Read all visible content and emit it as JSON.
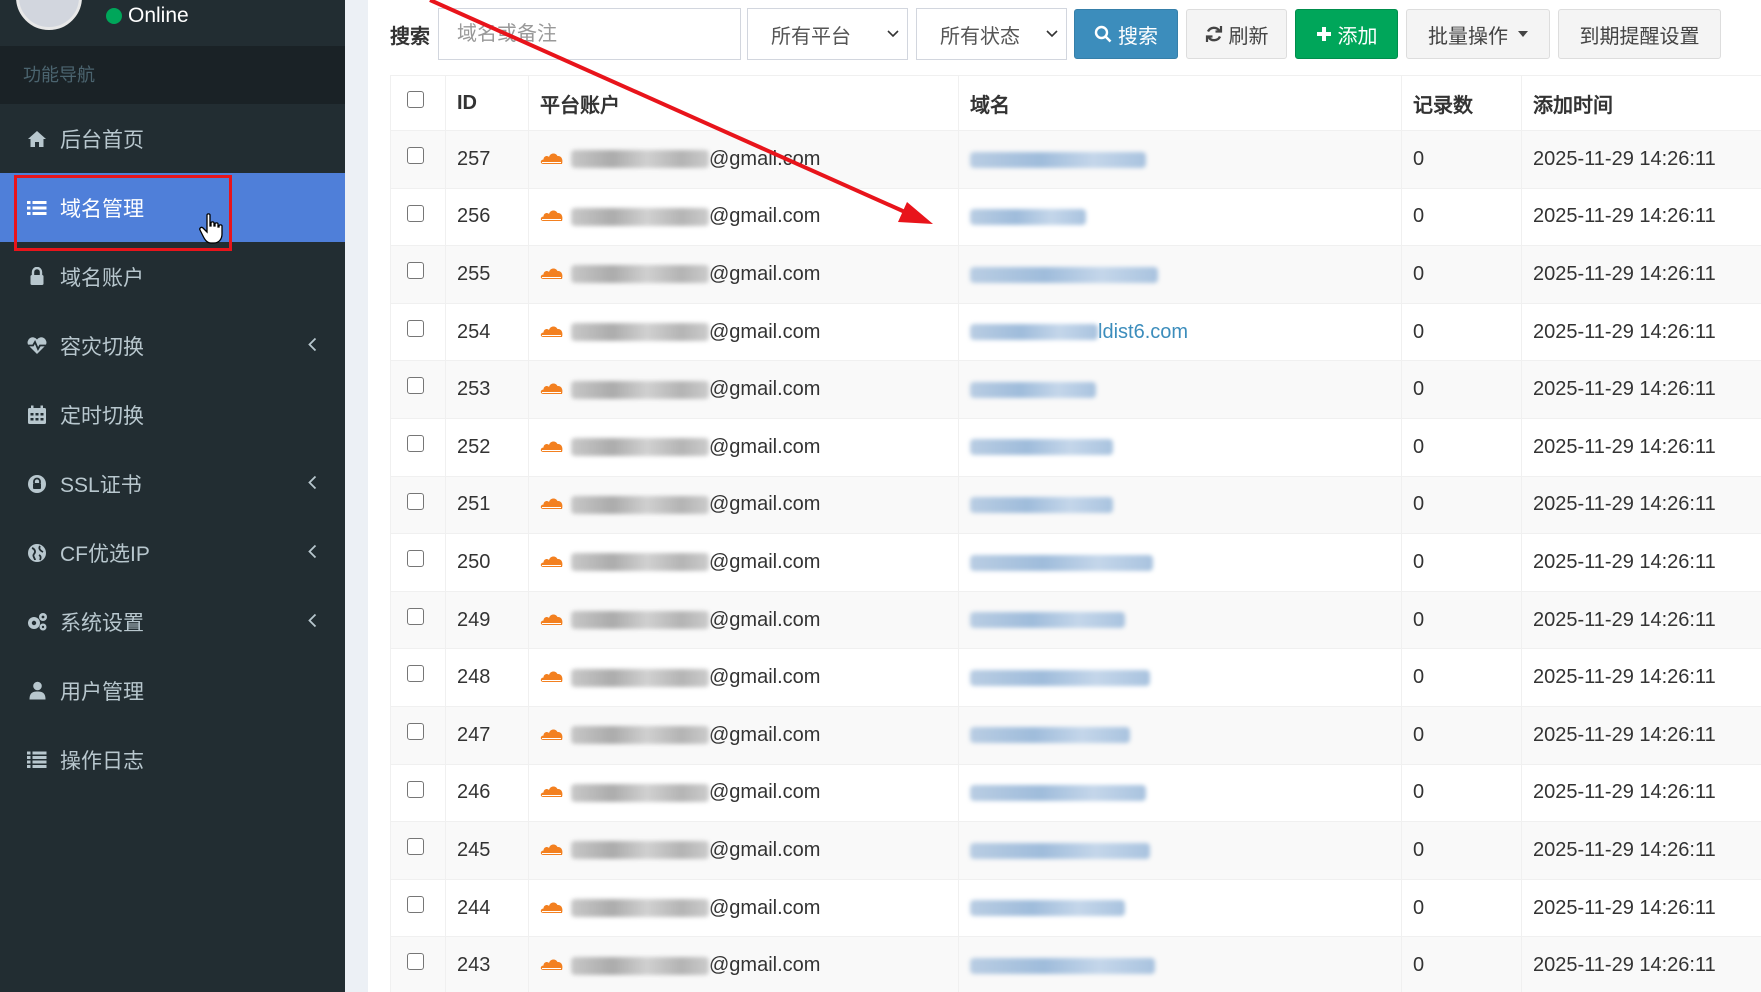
{
  "user": {
    "status": "Online"
  },
  "sidebar": {
    "header": "功能导航",
    "items": [
      {
        "label": "后台首页",
        "icon": "home-icon",
        "expandable": false,
        "active": false
      },
      {
        "label": "域名管理",
        "icon": "list-icon",
        "expandable": false,
        "active": true
      },
      {
        "label": "域名账户",
        "icon": "lock-icon",
        "expandable": false,
        "active": false
      },
      {
        "label": "容灾切换",
        "icon": "heartbeat-icon",
        "expandable": true,
        "active": false
      },
      {
        "label": "定时切换",
        "icon": "calendar-icon",
        "expandable": false,
        "active": false
      },
      {
        "label": "SSL证书",
        "icon": "ssl-lock-icon",
        "expandable": true,
        "active": false
      },
      {
        "label": "CF优选IP",
        "icon": "globe-icon",
        "expandable": true,
        "active": false
      },
      {
        "label": "系统设置",
        "icon": "cogs-icon",
        "expandable": true,
        "active": false
      },
      {
        "label": "用户管理",
        "icon": "user-icon",
        "expandable": false,
        "active": false
      },
      {
        "label": "操作日志",
        "icon": "list-alt-icon",
        "expandable": false,
        "active": false
      }
    ]
  },
  "toolbar": {
    "search_label": "搜索",
    "search_placeholder": "域名或备注",
    "platform_select": "所有平台",
    "status_select": "所有状态",
    "search_button": "搜索",
    "refresh_button": "刷新",
    "add_button": "添加",
    "batch_button": "批量操作",
    "expiry_button": "到期提醒设置"
  },
  "table": {
    "columns": [
      "ID",
      "平台账户",
      "域名",
      "记录数",
      "添加时间"
    ],
    "account_suffix": "@gmail.com",
    "rows": [
      {
        "id": "257",
        "domain_visible": "",
        "records": "0",
        "added": "2025-11-29 14:26:11"
      },
      {
        "id": "256",
        "domain_visible": "",
        "records": "0",
        "added": "2025-11-29 14:26:11"
      },
      {
        "id": "255",
        "domain_visible": "",
        "records": "0",
        "added": "2025-11-29 14:26:11"
      },
      {
        "id": "254",
        "domain_visible": "ldist6.com",
        "records": "0",
        "added": "2025-11-29 14:26:11"
      },
      {
        "id": "253",
        "domain_visible": "",
        "records": "0",
        "added": "2025-11-29 14:26:11"
      },
      {
        "id": "252",
        "domain_visible": "",
        "records": "0",
        "added": "2025-11-29 14:26:11"
      },
      {
        "id": "251",
        "domain_visible": "",
        "records": "0",
        "added": "2025-11-29 14:26:11"
      },
      {
        "id": "250",
        "domain_visible": "",
        "records": "0",
        "added": "2025-11-29 14:26:11"
      },
      {
        "id": "249",
        "domain_visible": "",
        "records": "0",
        "added": "2025-11-29 14:26:11"
      },
      {
        "id": "248",
        "domain_visible": "",
        "records": "0",
        "added": "2025-11-29 14:26:11"
      },
      {
        "id": "247",
        "domain_visible": "",
        "records": "0",
        "added": "2025-11-29 14:26:11"
      },
      {
        "id": "246",
        "domain_visible": "",
        "records": "0",
        "added": "2025-11-29 14:26:11"
      },
      {
        "id": "245",
        "domain_visible": "",
        "records": "0",
        "added": "2025-11-29 14:26:11"
      },
      {
        "id": "244",
        "domain_visible": "",
        "records": "0",
        "added": "2025-11-29 14:26:11"
      },
      {
        "id": "243",
        "domain_visible": "",
        "records": "0",
        "added": "2025-11-29 14:26:11"
      }
    ]
  },
  "colors": {
    "sidebar_bg": "#222d32",
    "active_item": "#4f7fd9",
    "primary": "#3c8dbc",
    "success": "#00a65a",
    "annotation_red": "#e8141b",
    "cloudflare_orange": "#f38020"
  }
}
